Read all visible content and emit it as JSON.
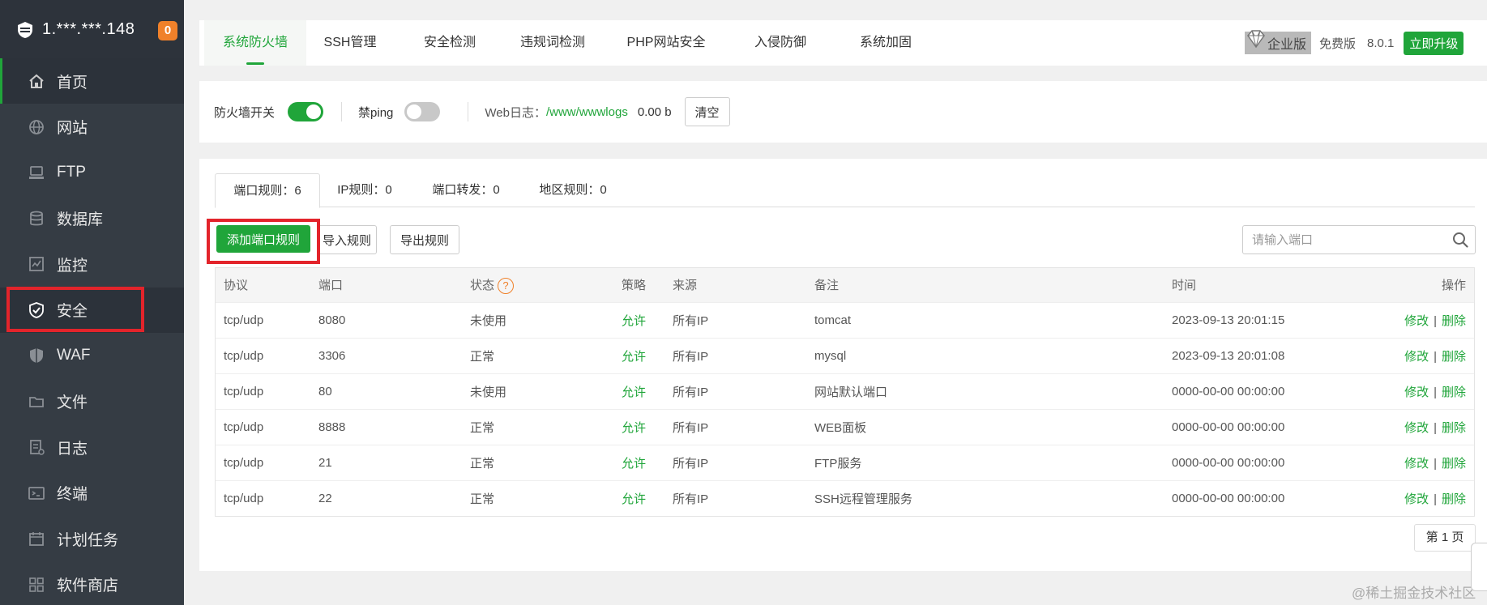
{
  "sidebar": {
    "server_ip": "1.***.***.148",
    "badge_count": "0",
    "items": [
      {
        "label": "首页",
        "icon": "home-icon"
      },
      {
        "label": "网站",
        "icon": "globe-icon"
      },
      {
        "label": "FTP",
        "icon": "ftp-icon"
      },
      {
        "label": "数据库",
        "icon": "database-icon"
      },
      {
        "label": "监控",
        "icon": "monitor-icon"
      },
      {
        "label": "安全",
        "icon": "shield-check-icon"
      },
      {
        "label": "WAF",
        "icon": "waf-shield-icon"
      },
      {
        "label": "文件",
        "icon": "folder-icon"
      },
      {
        "label": "日志",
        "icon": "log-icon"
      },
      {
        "label": "终端",
        "icon": "terminal-icon"
      },
      {
        "label": "计划任务",
        "icon": "calendar-icon"
      },
      {
        "label": "软件商店",
        "icon": "app-grid-icon"
      }
    ]
  },
  "topbar": {
    "tabs": [
      "系统防火墙",
      "SSH管理",
      "安全检测",
      "违规词检测",
      "PHP网站安全",
      "入侵防御",
      "系统加固"
    ],
    "enterprise_label": "企业版",
    "free_label": "免费版",
    "version": "8.0.1",
    "upgrade_label": "立即升级"
  },
  "status": {
    "firewall_label": "防火墙开关",
    "firewall_on": true,
    "ping_label": "禁ping",
    "ping_on": false,
    "weblog_label": "Web日志：",
    "weblog_path": "/www/wwwlogs",
    "weblog_size": "0.00 b",
    "clear_label": "清空"
  },
  "rules": {
    "sub_tabs": [
      "端口规则：6",
      "IP规则：0",
      "端口转发：0",
      "地区规则：0"
    ],
    "add_label": "添加端口规则",
    "import_label": "导入规则",
    "export_label": "导出规则",
    "search_placeholder": "请输入端口",
    "columns": [
      "协议",
      "端口",
      "状态",
      "策略",
      "来源",
      "备注",
      "时间",
      "操作"
    ],
    "rows": [
      {
        "protocol": "tcp/udp",
        "port": "8080",
        "status": "未使用",
        "policy": "允许",
        "source": "所有IP",
        "note": "tomcat",
        "time": "2023-09-13 20:01:15"
      },
      {
        "protocol": "tcp/udp",
        "port": "3306",
        "status": "正常",
        "policy": "允许",
        "source": "所有IP",
        "note": "mysql",
        "time": "2023-09-13 20:01:08"
      },
      {
        "protocol": "tcp/udp",
        "port": "80",
        "status": "未使用",
        "policy": "允许",
        "source": "所有IP",
        "note": "网站默认端口",
        "time": "0000-00-00 00:00:00"
      },
      {
        "protocol": "tcp/udp",
        "port": "8888",
        "status": "正常",
        "policy": "允许",
        "source": "所有IP",
        "note": "WEB面板",
        "time": "0000-00-00 00:00:00"
      },
      {
        "protocol": "tcp/udp",
        "port": "21",
        "status": "正常",
        "policy": "允许",
        "source": "所有IP",
        "note": "FTP服务",
        "time": "0000-00-00 00:00:00"
      },
      {
        "protocol": "tcp/udp",
        "port": "22",
        "status": "正常",
        "policy": "允许",
        "source": "所有IP",
        "note": "SSH远程管理服务",
        "time": "0000-00-00 00:00:00"
      }
    ],
    "edit_label": "修改",
    "delete_label": "删除",
    "page_label": "第 1 页"
  },
  "watermark": "@稀土掘金技术社区",
  "colors": {
    "accent": "#20a53a",
    "sidebar_bg": "#353c44",
    "highlight": "#e3242b",
    "badge": "#f0812a"
  }
}
